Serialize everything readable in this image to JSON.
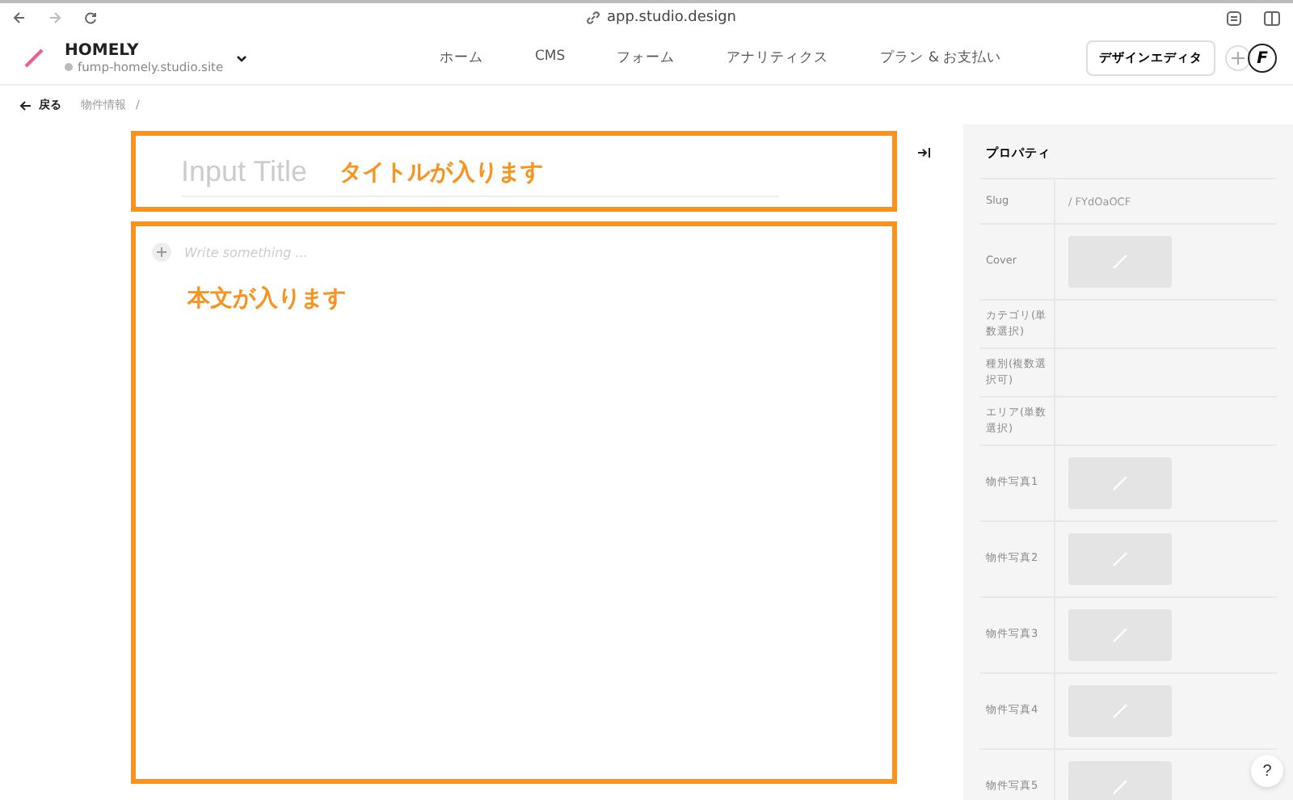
{
  "browser": {
    "url": "app.studio.design"
  },
  "header": {
    "project": "HOMELY",
    "site": "fump-homely.studio.site",
    "nav": [
      {
        "label": "ホーム"
      },
      {
        "label": "CMS"
      },
      {
        "label": "フォーム"
      },
      {
        "label": "アナリティクス"
      },
      {
        "label": "プラン & お支払い"
      }
    ],
    "design_button": "デザインエディタ",
    "avatar": "F"
  },
  "breadcrumb": {
    "back": "戻る",
    "path": "物件情報",
    "separator": "/"
  },
  "editor": {
    "title_placeholder": "Input Title",
    "body_placeholder": "Write something ...",
    "title_annotation": "タイトルが入ります",
    "body_annotation": "本文が入ります"
  },
  "properties": {
    "heading": "プロパティ",
    "rows": [
      {
        "label": "Slug",
        "kind": "text",
        "value": "/ FYdOaOCF"
      },
      {
        "label": "Cover",
        "kind": "image"
      },
      {
        "label": "カテゴリ(単数選択)",
        "kind": "empty"
      },
      {
        "label": "種別(複数選択可)",
        "kind": "empty"
      },
      {
        "label": "エリア(単数選択)",
        "kind": "empty"
      },
      {
        "label": "物件写真1",
        "kind": "image"
      },
      {
        "label": "物件写真2",
        "kind": "image"
      },
      {
        "label": "物件写真3",
        "kind": "image"
      },
      {
        "label": "物件写真4",
        "kind": "image"
      },
      {
        "label": "物件写真5",
        "kind": "image"
      }
    ]
  },
  "help": "?"
}
